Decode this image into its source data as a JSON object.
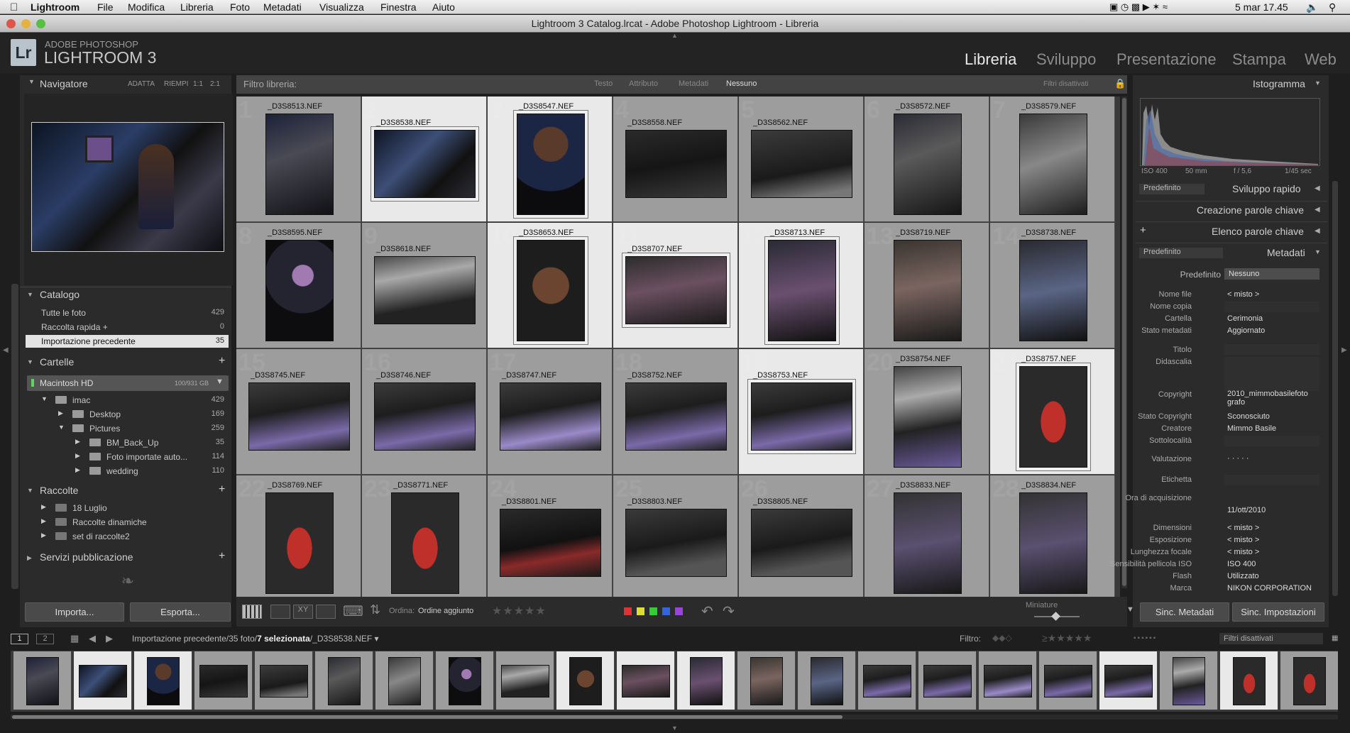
{
  "menubar": {
    "app": "Lightroom",
    "items": [
      "File",
      "Modifica",
      "Libreria",
      "Foto",
      "Metadati",
      "Visualizza",
      "Finestra",
      "Aiuto"
    ],
    "clock": "5 mar  17.45"
  },
  "window": {
    "title": "Lightroom 3 Catalog.lrcat - Adobe Photoshop Lightroom - Libreria"
  },
  "identity": {
    "logo": "Lr",
    "line1": "ADOBE PHOTOSHOP",
    "line2": "LIGHTROOM 3"
  },
  "modules": [
    {
      "label": "Libreria",
      "active": true
    },
    {
      "label": "Sviluppo",
      "active": false
    },
    {
      "label": "Presentazione",
      "active": false
    },
    {
      "label": "Stampa",
      "active": false
    },
    {
      "label": "Web",
      "active": false
    }
  ],
  "navigator": {
    "title": "Navigatore",
    "zoom": [
      "ADATTA",
      "RIEMPI",
      "1:1",
      "2:1"
    ]
  },
  "catalog": {
    "title": "Catalogo",
    "items": [
      {
        "label": "Tutte le foto",
        "count": "429"
      },
      {
        "label": "Raccolta rapida +",
        "count": "0"
      },
      {
        "label": "Importazione precedente",
        "count": "35"
      }
    ]
  },
  "folders": {
    "title": "Cartelle",
    "volume": {
      "label": "Macintosh HD",
      "info": "100/931 GB"
    },
    "items": [
      {
        "label": "imac",
        "count": "429"
      },
      {
        "label": "Desktop",
        "count": "169"
      },
      {
        "label": "Pictures",
        "count": "259"
      },
      {
        "label": "BM_Back_Up",
        "count": "35"
      },
      {
        "label": "Foto importate auto...",
        "count": "114"
      },
      {
        "label": "wedding",
        "count": "110"
      }
    ]
  },
  "collections": {
    "title": "Raccolte",
    "items": [
      {
        "label": "18 Luglio"
      },
      {
        "label": "Raccolte dinamiche"
      },
      {
        "label": "set di raccolte2"
      }
    ]
  },
  "publish": {
    "title": "Servizi pubblicazione"
  },
  "left_buttons": {
    "import": "Importa...",
    "export": "Esporta..."
  },
  "filterbar": {
    "title": "Filtro libreria:",
    "options": [
      "Testo",
      "Attributo",
      "Metadati",
      "Nessuno"
    ],
    "preset": "Filtri disattivati"
  },
  "grid": {
    "files": [
      "_D3S8513.NEF",
      "_D3S8538.NEF",
      "_D3S8547.NEF",
      "_D3S8558.NEF",
      "_D3S8562.NEF",
      "_D3S8572.NEF",
      "_D3S8579.NEF",
      "_D3S8595.NEF",
      "_D3S8618.NEF",
      "_D3S8653.NEF",
      "_D3S8707.NEF",
      "_D3S8713.NEF",
      "_D3S8719.NEF",
      "_D3S8738.NEF",
      "_D3S8745.NEF",
      "_D3S8746.NEF",
      "_D3S8747.NEF",
      "_D3S8752.NEF",
      "_D3S8753.NEF",
      "_D3S8754.NEF",
      "_D3S8757.NEF",
      "_D3S8769.NEF",
      "_D3S8771.NEF",
      "_D3S8801.NEF",
      "_D3S8803.NEF",
      "_D3S8805.NEF",
      "_D3S8833.NEF",
      "_D3S8834.NEF"
    ],
    "indices": [
      "1",
      "2",
      "3",
      "4",
      "5",
      "6",
      "7",
      "8",
      "9",
      "10",
      "11",
      "12",
      "13",
      "14",
      "15",
      "16",
      "17",
      "18",
      "19",
      "20",
      "21",
      "22",
      "23",
      "24",
      "25",
      "26",
      "27",
      "28"
    ]
  },
  "toolbar": {
    "sort_label": "Ordina:",
    "sort_value": "Ordine aggiunto",
    "thumb_label": "Miniature"
  },
  "histogram": {
    "title": "Istogramma",
    "iso": "ISO 400",
    "focal": "50 mm",
    "aperture": "f / 5,6",
    "shutter": "1/45 sec"
  },
  "quick_develop": {
    "preset": "Predefinito",
    "title": "Sviluppo rapido"
  },
  "keywording": {
    "title": "Creazione parole chiave"
  },
  "keyword_list": {
    "title": "Elenco parole chiave"
  },
  "metadata": {
    "preset": "Predefinito",
    "title": "Metadati",
    "preset_label": "Predefinito",
    "preset_value": "Nessuno",
    "fields": [
      {
        "label": "Nome file",
        "value": "< misto >"
      },
      {
        "label": "Nome copia",
        "value": ""
      },
      {
        "label": "Cartella",
        "value": "Cerimonia"
      },
      {
        "label": "Stato metadati",
        "value": "Aggiornato"
      },
      {
        "label": "Titolo",
        "value": ""
      },
      {
        "label": "Didascalia",
        "value": ""
      },
      {
        "label": "Copyright",
        "value": "2010_mimmobasilefoto grafo"
      },
      {
        "label": "Stato Copyright",
        "value": "Sconosciuto"
      },
      {
        "label": "Creatore",
        "value": "Mimmo Basile"
      },
      {
        "label": "Sottolocalità",
        "value": ""
      },
      {
        "label": "Valutazione",
        "value": "·  ·  ·  ·  ·"
      },
      {
        "label": "Etichetta",
        "value": ""
      },
      {
        "label": "Ora di acquisizione",
        "value": ""
      },
      {
        "label": "",
        "value": "11/ott/2010"
      },
      {
        "label": "Dimensioni",
        "value": "< misto >"
      },
      {
        "label": "Esposizione",
        "value": "< misto >"
      },
      {
        "label": "Lunghezza focale",
        "value": "< misto >"
      },
      {
        "label": "Sensibilità pellicola ISO",
        "value": "ISO 400"
      },
      {
        "label": "Flash",
        "value": "Utilizzato"
      },
      {
        "label": "Marca",
        "value": "NIKON CORPORATION"
      }
    ]
  },
  "right_buttons": {
    "sync_meta": "Sinc. Metadati",
    "sync_settings": "Sinc. Impostazioni"
  },
  "filmstrip_bar": {
    "screens": [
      "1",
      "2"
    ],
    "path_prefix": "Importazione precedente/35 foto/",
    "path_selected": "7 selezionata",
    "path_file": "/_D3S8538.NEF",
    "filter_label": "Filtro:",
    "filter_preset": "Filtri disattivati"
  },
  "colors": {
    "bg": "#1e1e1e",
    "panel": "#2b2b2b",
    "grid": "#3a3a3a",
    "selected_cell": "#e9e9e9",
    "accent_red": "#c0302b"
  }
}
